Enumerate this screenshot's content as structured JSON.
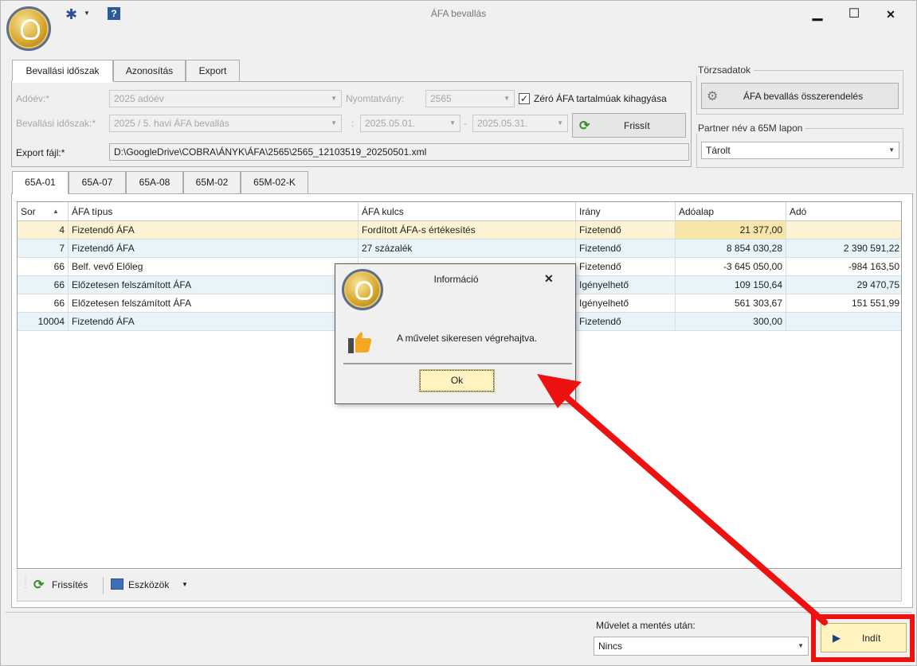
{
  "window": {
    "title": "ÁFA bevallás",
    "minimize": "▁",
    "maximize": "☐",
    "close": "✕"
  },
  "toolbar_icons": {
    "gear": "gear-icon",
    "help": "help-icon",
    "help_glyph": "?"
  },
  "main_tabs": [
    {
      "label": "Bevallási időszak",
      "active": true
    },
    {
      "label": "Azonosítás",
      "active": false
    },
    {
      "label": "Export",
      "active": false
    }
  ],
  "form": {
    "adoev_label": "Adóév:*",
    "adoev_value": "2025 adóév",
    "nyomtatvany_label": "Nyomtatvány:",
    "nyomtatvany_value": "2565",
    "zero_afa_label": "Zéró ÁFA tartalmúak kihagyása",
    "zero_afa_checked": true,
    "checkmark": "✓",
    "idoszak_label": "Bevallási időszak:*",
    "idoszak_value": "2025 / 5. havi ÁFA bevallás",
    "colon": ":",
    "date_from": "2025.05.01.",
    "dash": "-",
    "date_to": "2025.05.31.",
    "frissit_label": "Frissít",
    "export_label": "Export fájl:*",
    "export_value": "D:\\GoogleDrive\\COBRA\\ÁNYK\\ÁFA\\2565\\2565_12103519_20250501.xml"
  },
  "torzsadatok": {
    "title": "Törzsadatok",
    "button_label": "ÁFA bevallás összerendelés"
  },
  "partner": {
    "title": "Partner név a 65M lapon",
    "value": "Tárolt"
  },
  "sub_tabs": [
    {
      "label": "65A-01",
      "active": true
    },
    {
      "label": "65A-07",
      "active": false
    },
    {
      "label": "65A-08",
      "active": false
    },
    {
      "label": "65M-02",
      "active": false
    },
    {
      "label": "65M-02-K",
      "active": false
    }
  ],
  "grid": {
    "sort_glyph": "▲",
    "columns": [
      "Sor",
      "ÁFA típus",
      "ÁFA kulcs",
      "Irány",
      "Adóalap",
      "Adó"
    ],
    "rows": [
      {
        "sor": "4",
        "tipus": "Fizetendő ÁFA",
        "kulcs": "Fordított ÁFA-s értékesítés",
        "irany": "Fizetendő",
        "adoalap": "21 377,00",
        "ado": "",
        "bg": "#fdf3d4"
      },
      {
        "sor": "7",
        "tipus": "Fizetendő ÁFA",
        "kulcs": "27 százalék",
        "irany": "Fizetendő",
        "adoalap": "8 854 030,28",
        "ado": "2 390 591,22",
        "bg": "#e7f5fb"
      },
      {
        "sor": "66",
        "tipus": "Belf. vevő Előleg",
        "kulcs": "",
        "irany": "Fizetendő",
        "adoalap": "-3 645 050,00",
        "ado": "-984 163,50",
        "bg": "#ffffff"
      },
      {
        "sor": "66",
        "tipus": "Előzetesen felszámított ÁFA",
        "kulcs": "",
        "irany": "Igényelhető",
        "adoalap": "109 150,64",
        "ado": "29 470,75",
        "bg": "#e7f5fb"
      },
      {
        "sor": "66",
        "tipus": "Előzetesen felszámított ÁFA",
        "kulcs": "",
        "irany": "Igényelhető",
        "adoalap": "561 303,67",
        "ado": "151 551,99",
        "bg": "#ffffff"
      },
      {
        "sor": "10004",
        "tipus": "Fizetendő ÁFA",
        "kulcs": "",
        "irany": "Fizetendő",
        "adoalap": "300,00",
        "ado": "",
        "bg": "#e7f5fb"
      }
    ]
  },
  "bottom_toolbar": {
    "frissites_label": "Frissítés",
    "eszkozok_label": "Eszközök"
  },
  "footer": {
    "muvelet_label": "Művelet a mentés után:",
    "muvelet_value": "Nincs",
    "indit_label": "Indít"
  },
  "dialog": {
    "title": "Információ",
    "close": "✕",
    "message": "A művelet sikeresen végrehajtva.",
    "ok_label": "Ok"
  },
  "colors": {
    "selected_row": "#fdf3d4",
    "alt_row": "#e7f5fb",
    "annotation_red": "#ee1111",
    "accent_blue": "#2b4f91",
    "refresh_green": "#3a8a2e"
  }
}
